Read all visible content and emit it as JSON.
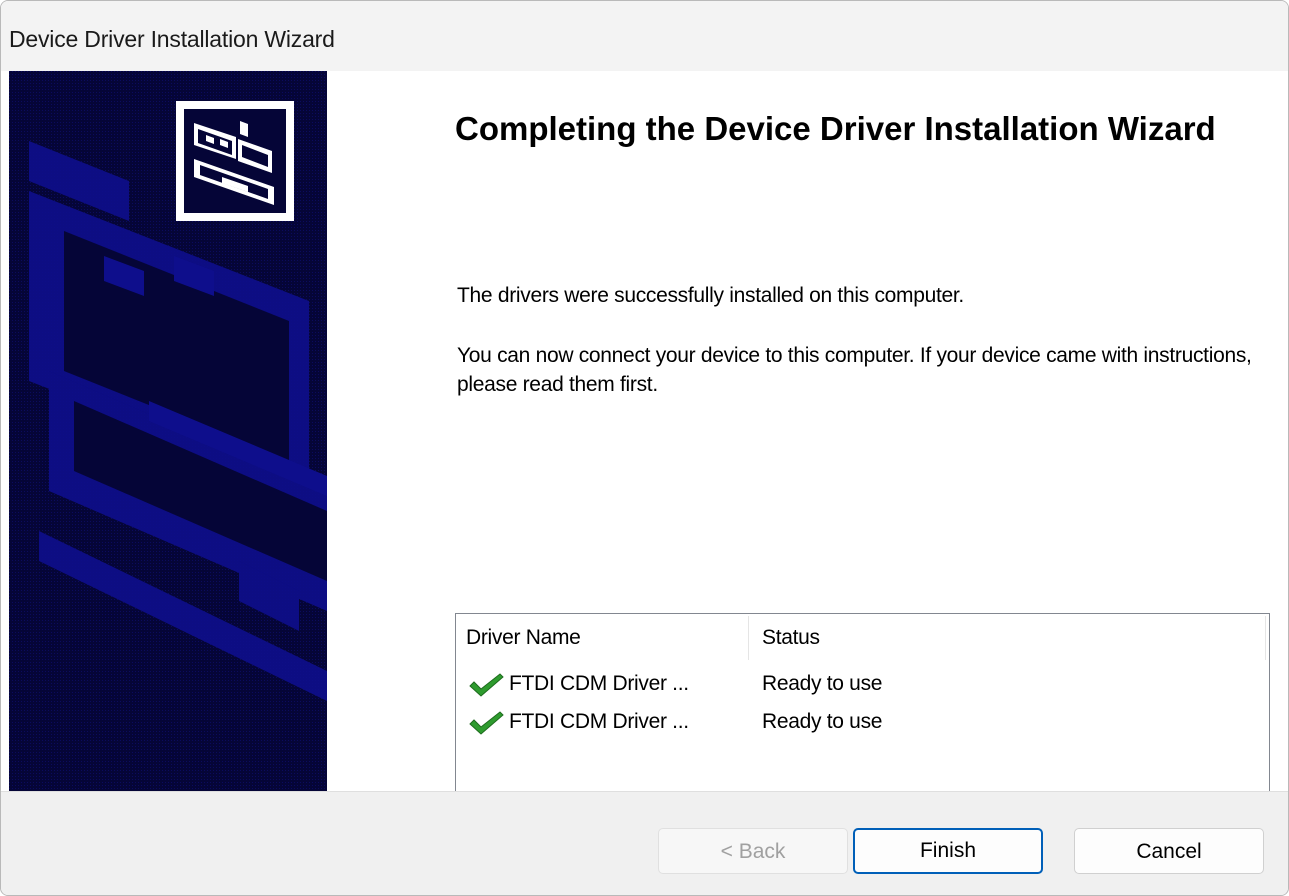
{
  "window": {
    "title": "Device Driver Installation Wizard"
  },
  "main": {
    "heading": "Completing the Device Driver Installation Wizard",
    "paragraph1": "The drivers were successfully installed on this computer.",
    "paragraph2": "You can now connect your device to this computer. If your device came with instructions, please read them first."
  },
  "driver_list": {
    "columns": [
      "Driver Name",
      "Status"
    ],
    "rows": [
      {
        "icon": "green-checkmark-icon",
        "name": "FTDI CDM Driver ...",
        "status": "Ready to use"
      },
      {
        "icon": "green-checkmark-icon",
        "name": "FTDI CDM Driver ...",
        "status": "Ready to use"
      }
    ]
  },
  "buttons": {
    "back": "< Back",
    "finish": "Finish",
    "cancel": "Cancel"
  },
  "colors": {
    "banner_background": "#050537",
    "banner_pattern": "#0e0e8c",
    "checkmark": "#2e9b2e",
    "default_button_border": "#005fb8"
  }
}
